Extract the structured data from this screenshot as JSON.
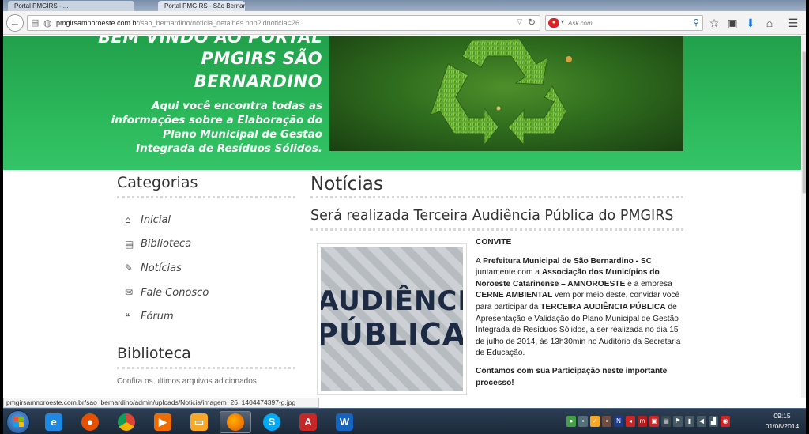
{
  "browser": {
    "tabs": [
      {
        "label": "Portal PMGIRS - ..."
      },
      {
        "label": "Portal PMGIRS - São Bernardino"
      }
    ],
    "url_host": "pmgirsamnoroeste.com.br",
    "url_path": "/sao_bernardino/noticia_detalhes.php?idnoticia=26",
    "search_placeholder": "Ask.com"
  },
  "banner": {
    "title_lines": [
      "BEM VINDO AO PORTAL",
      "PMGIRS SÃO",
      "BERNARDINO"
    ],
    "tagline": "Aqui você encontra todas as informações sobre a Elaboração do Plano Municipal de Gestão Integrada de Resíduos Sólidos."
  },
  "sidebar": {
    "categories_title": "Categorias",
    "items": [
      {
        "label": "Inicial",
        "icon": "home-icon"
      },
      {
        "label": "Biblioteca",
        "icon": "book-icon"
      },
      {
        "label": "Notícias",
        "icon": "pencil-icon"
      },
      {
        "label": "Fale Conosco",
        "icon": "envelope-icon"
      },
      {
        "label": "Fórum",
        "icon": "comments-icon"
      }
    ],
    "library_title": "Biblioteca",
    "library_text": "Confira os ultimos arquivos adicionados"
  },
  "main": {
    "section_title": "Notícias",
    "article_title": "Será realizada Terceira Audiência Pública do PMGIRS",
    "image_words": [
      "AUDIÊNCIA",
      "PÚBLICA"
    ],
    "convite": "CONVITE",
    "p1": {
      "a": "A ",
      "b1": "Prefeitura Municipal de São Bernardino - SC",
      "c": " juntamente com a ",
      "b2": "Associação dos Municípios do Noroeste Catarinense – AMNOROESTE",
      "d": " e a empresa ",
      "b3": "CERNE AMBIENTAL",
      "e": " vem por meio deste, convidar você para participar da ",
      "b4": "TERCEIRA AUDIÊNCIA PÚBLICA",
      "f": " de Apresentação e Validação do Plano Municipal de Gestão Integrada de Resíduos Sólidos, a ser realizada no dia 15 de julho de 2014, às 13h30min no Auditório da Secretaria de Educação."
    },
    "p2": "Contamos com sua Participação neste importante processo!"
  },
  "statusbar": {
    "text": "pmgirsamnoroeste.com.br/sao_bernardino/admin/uploads/Noticia/imagem_26_1404474397-g.jpg"
  },
  "taskbar": {
    "apps": [
      {
        "name": "internet-explorer-icon",
        "glyph": "e",
        "color": "#1e88e5"
      },
      {
        "name": "media-player-icon",
        "glyph": "●",
        "color": "#e65100"
      },
      {
        "name": "chrome-icon",
        "glyph": "◉",
        "color": "#43a047"
      },
      {
        "name": "media-center-icon",
        "glyph": "▶",
        "color": "#ef6c00"
      },
      {
        "name": "file-explorer-icon",
        "glyph": "▭",
        "color": "#f9a825"
      },
      {
        "name": "firefox-icon",
        "glyph": "◕",
        "color": "#e65100"
      },
      {
        "name": "skype-icon",
        "glyph": "S",
        "color": "#03a9f4"
      },
      {
        "name": "acrobat-icon",
        "glyph": "A",
        "color": "#c62828"
      },
      {
        "name": "word-icon",
        "glyph": "W",
        "color": "#1565c0"
      }
    ],
    "time": "09:15",
    "date": "01/08/2014"
  },
  "colors": {
    "banner_green": "#2bb85a",
    "taskbar": "#1b2a3a"
  }
}
